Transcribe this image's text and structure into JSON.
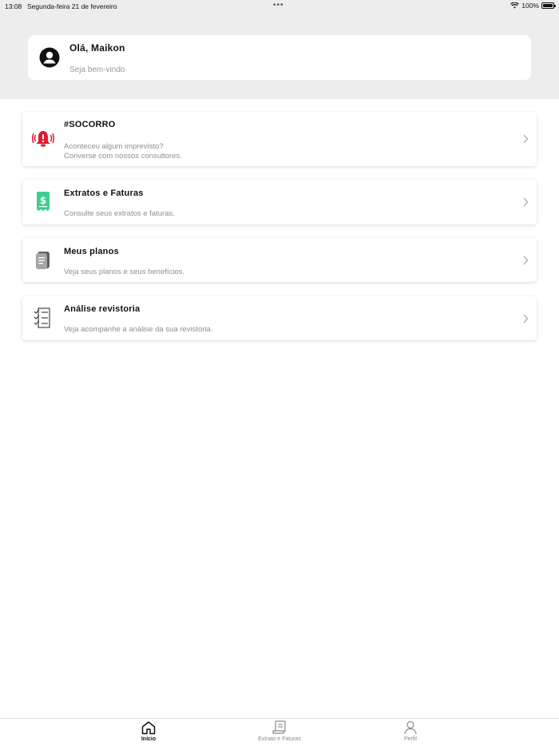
{
  "status_bar": {
    "time": "13:08",
    "date": "Segunda-feira 21 de fevereiro",
    "dots": "•••",
    "battery": "100%"
  },
  "welcome": {
    "greeting": "Olá, Maikon",
    "subtitle": "Seja bem-vindo"
  },
  "menu": {
    "items": [
      {
        "title": "#SOCORRO",
        "description_line1": "Aconteceu algum imprevisto?",
        "description_line2": "Converse com nossos consultores.",
        "icon": "alarm-bell-icon",
        "icon_color": "#e0182d"
      },
      {
        "title": "Extratos e Faturas",
        "description_line1": "Consulte seus extratos e faturas.",
        "icon": "invoice-dollar-icon",
        "icon_color": "#3ccf8e"
      },
      {
        "title": "Meus planos",
        "description_line1": "Veja seus planos e seus benefícios.",
        "icon": "plans-document-icon",
        "icon_color": "#8e8e8e"
      },
      {
        "title": "Análise revistoria",
        "description_line1": "Veja acompanhe a análise da sua revistoria.",
        "icon": "checklist-icon",
        "icon_color": "#333333"
      }
    ]
  },
  "tabbar": {
    "tabs": [
      {
        "label": "Início",
        "icon": "home-icon",
        "active": true
      },
      {
        "label": "Extrato e Faturas",
        "icon": "receipt-icon",
        "active": false
      },
      {
        "label": "Perfil",
        "icon": "user-icon",
        "active": false
      }
    ]
  }
}
